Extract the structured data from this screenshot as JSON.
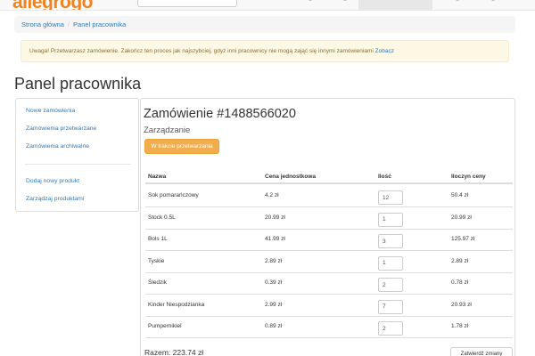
{
  "navbar": {
    "brand": "allegrogo"
  },
  "breadcrumb": {
    "home": "Strona główna",
    "current": "Panel pracownika"
  },
  "alert": {
    "text": "Uwaga! Przetwarzasz zamówienie. Zakończ ten proces jak najszybciej, gdyż inni pracownicy nie mogą zająć się innymi zamówieniami",
    "link": "Zobacz"
  },
  "page_title": "Panel pracownika",
  "sidebar": {
    "items": [
      {
        "label": "Nowe zamówienia"
      },
      {
        "label": "Zamówienia przetwarzane"
      },
      {
        "label": "Zamówienia archiwalne"
      },
      {
        "label": "Dodaj nowy produkt"
      },
      {
        "label": "Zarządzaj produktami"
      }
    ]
  },
  "order": {
    "title": "Zamówienie #1488566020",
    "subtitle": "Zarządzanie",
    "status_button": "W trakcie przetwarzania",
    "columns": {
      "name": "Nazwa",
      "unit_price": "Cena jednostkowa",
      "quantity": "Ilość",
      "total": "Iloczyn ceny"
    },
    "rows": [
      {
        "name": "Sok pomarańczowy",
        "price": "4.2 zł",
        "qty": "12",
        "total": "50.4 zł"
      },
      {
        "name": "Stock 0.5L",
        "price": "20.99 zł",
        "qty": "1",
        "total": "20.99 zł"
      },
      {
        "name": "Bols 1L",
        "price": "41.99 zł",
        "qty": "3",
        "total": "125.97 zł"
      },
      {
        "name": "Tyskie",
        "price": "2.89 zł",
        "qty": "1",
        "total": "2.89 zł"
      },
      {
        "name": "Śledzik",
        "price": "0.39 zł",
        "qty": "2",
        "total": "0.78 zł"
      },
      {
        "name": "Kinder Niespodzianka",
        "price": "2.99 zł",
        "qty": "7",
        "total": "20.93 zł"
      },
      {
        "name": "Pumpernikiel",
        "price": "0.89 zł",
        "qty": "2",
        "total": "1.78 zł"
      }
    ],
    "total_label": "Razem: 223.74 zł",
    "confirm_button": "Zatwierdź zmiany"
  },
  "colors": {
    "brand": "#f0831f",
    "link": "#337ab7",
    "warning_button": "#f0ad4e",
    "alert_bg": "#fcf8e3"
  }
}
